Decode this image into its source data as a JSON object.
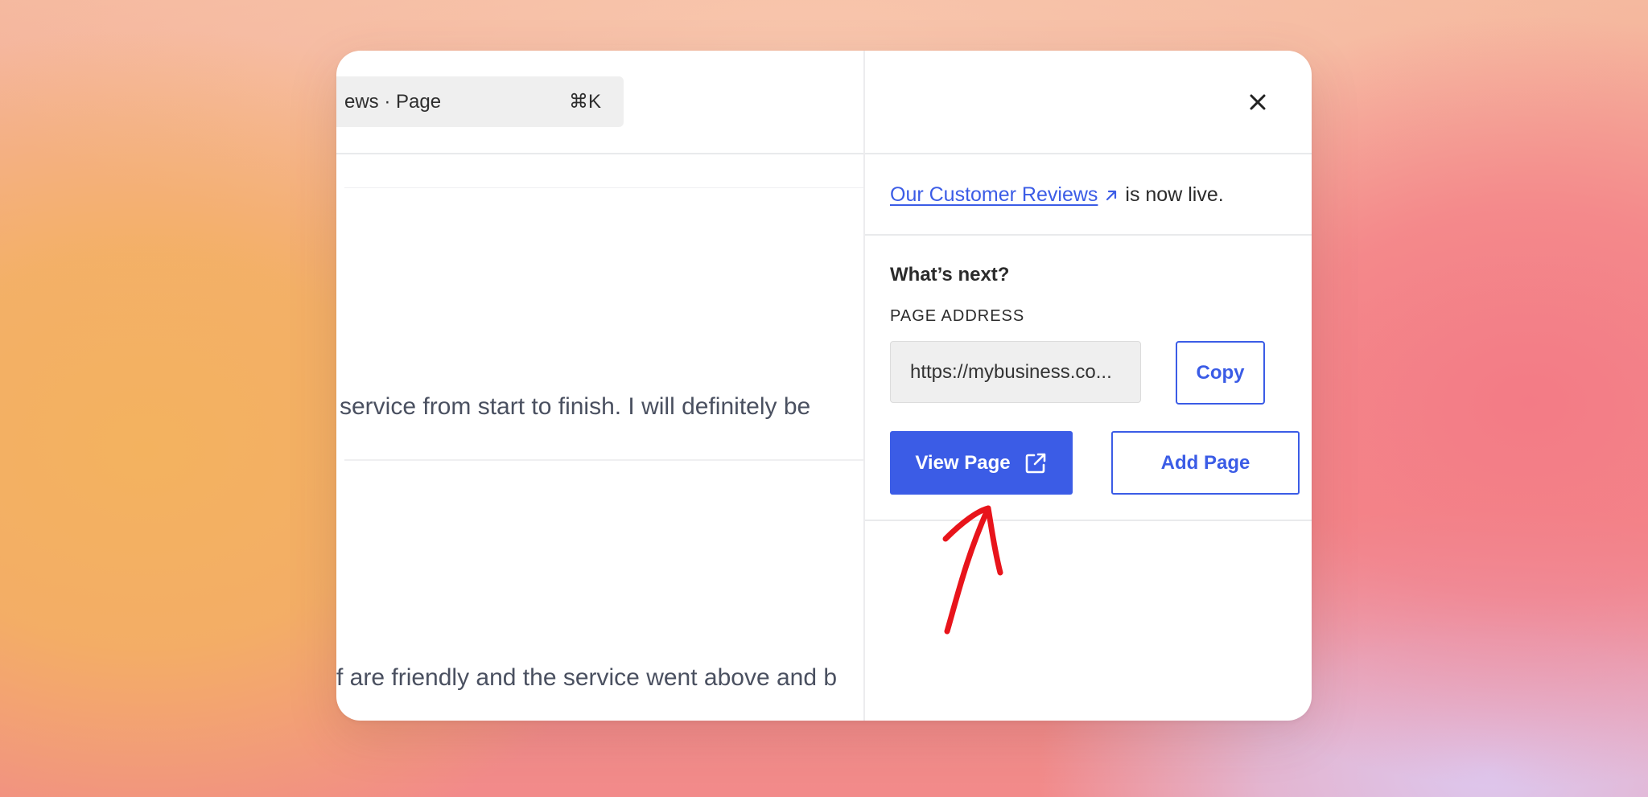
{
  "search": {
    "text": "ews · Page",
    "shortcut": "⌘K"
  },
  "editor": {
    "review_snippets": [
      "service from start to finish. I will definitely be",
      "f are friendly and the service went above and b"
    ]
  },
  "panel": {
    "page_link": "Our Customer Reviews",
    "live_suffix": "is now live.",
    "next_title": "What’s next?",
    "address_label": "PAGE ADDRESS",
    "address_value": "https://mybusiness.co...",
    "copy_label": "Copy",
    "view_label": "View Page",
    "add_label": "Add Page"
  },
  "icons": {
    "close": "close-icon",
    "link_arrow": "external-arrow-icon",
    "view_external": "external-link-icon"
  },
  "colors": {
    "accent": "#3b5ce6",
    "annotation": "#e8141b"
  }
}
